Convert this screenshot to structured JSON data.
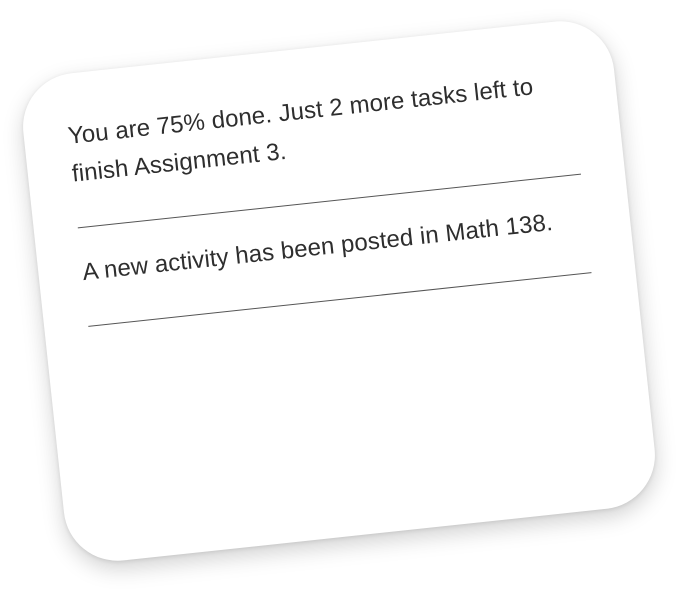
{
  "notifications": [
    {
      "text": "You are 75% done. Just 2 more tasks left to finish Assignment 3."
    },
    {
      "text": "A new activity has been posted in Math 138."
    }
  ],
  "colors": {
    "card_background": "#ffffff",
    "text": "#2e2e2e",
    "divider": "#555555"
  }
}
